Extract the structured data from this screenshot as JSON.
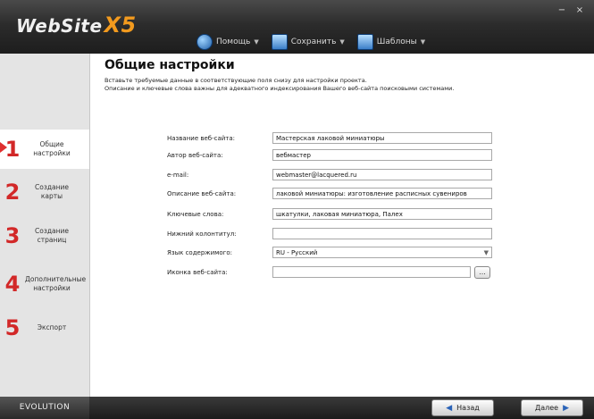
{
  "app": {
    "logo": "WebSite",
    "logo_suffix": "X5",
    "toolbar": [
      {
        "icon": "help-icon",
        "label": "Помощь"
      },
      {
        "icon": "save-icon",
        "label": "Сохранить"
      },
      {
        "icon": "template-icon",
        "label": "Шаблоны"
      }
    ],
    "window_controls": [
      "−",
      "×"
    ]
  },
  "sidebar": {
    "steps": [
      {
        "num": "1",
        "label": "Общие настройки",
        "active": true
      },
      {
        "num": "2",
        "label": "Создание карты"
      },
      {
        "num": "3",
        "label": "Создание страниц"
      },
      {
        "num": "4",
        "label": "Дополнительные настройки"
      },
      {
        "num": "5",
        "label": "Экспорт"
      }
    ]
  },
  "main": {
    "title": "Общие настройки",
    "description_line1": "Вставьте требуемые данные в соответствующие поля снизу для настройки проекта.",
    "description_line2": "Описание и ключевые слова важны для адекватного индексирования Вашего веб-сайта поисковыми системами.",
    "fields": [
      {
        "label": "Название веб-сайта:",
        "value": "Мастерская лаковой миниатюры"
      },
      {
        "label": "Автор веб-сайта:",
        "value": "вебмастер"
      },
      {
        "label": "e-mail:",
        "value": "webmaster@lacquered.ru"
      },
      {
        "label": "Описание веб-сайта:",
        "value": "лаковой миниатюры: изготовление расписных сувениров"
      },
      {
        "label": "Ключевые слова:",
        "value": "шкатулки, лаковая миниатюра, Палех"
      },
      {
        "label": "Нижний колонтитул:",
        "value": ""
      },
      {
        "label": "Язык содержимого:",
        "value": "RU - Русский"
      },
      {
        "label": "Иконка веб-сайта:",
        "value": ""
      }
    ],
    "browse_label": "..."
  },
  "footer": {
    "brand": "EVOLUTION",
    "back_label": "Назад",
    "next_label": "Далее"
  }
}
